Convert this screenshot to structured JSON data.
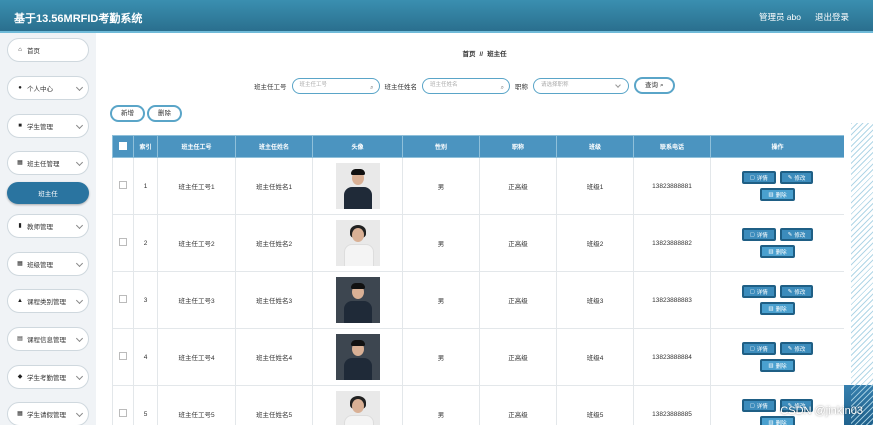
{
  "app": {
    "title": "基于13.56MRFID考勤系统"
  },
  "header": {
    "user": "管理员 abo",
    "logout": "退出登录"
  },
  "sidebar": {
    "items": [
      {
        "label": "首页",
        "icon": "home-icon"
      },
      {
        "label": "个人中心",
        "icon": "user-icon"
      },
      {
        "label": "学生管理",
        "icon": "briefcase-icon"
      },
      {
        "label": "班主任管理",
        "icon": "grid-icon"
      },
      {
        "label": "教师管理",
        "icon": "clipboard-icon"
      },
      {
        "label": "班级管理",
        "icon": "grid-icon"
      },
      {
        "label": "课程类别管理",
        "icon": "person-icon"
      },
      {
        "label": "课程信息管理",
        "icon": "table-icon"
      },
      {
        "label": "学生考勤管理",
        "icon": "pin-icon"
      },
      {
        "label": "学生请假管理",
        "icon": "grid-icon"
      }
    ],
    "submenu": {
      "label": "班主任"
    }
  },
  "breadcrumb": {
    "home": "首页",
    "separator": "//",
    "current": "班主任"
  },
  "search": {
    "field1_label": "班主任工号",
    "field1_placeholder": "班主任工号",
    "field2_label": "班主任姓名",
    "field2_placeholder": "班主任姓名",
    "field3_label": "职称",
    "field3_placeholder": "请选择职称",
    "button": "查询"
  },
  "actions": {
    "add": "新增",
    "delete": "删除"
  },
  "table": {
    "headers": [
      "索引",
      "班主任工号",
      "班主任姓名",
      "头像",
      "性别",
      "职称",
      "班级",
      "联系电话",
      "操作"
    ],
    "ops": {
      "detail": "详情",
      "edit": "修改",
      "delete": "删除"
    },
    "rows": [
      {
        "index": "1",
        "no": "班主任工号1",
        "name": "班主任姓名1",
        "gender": "男",
        "title": "正高级",
        "class": "班级1",
        "phone": "13823888881"
      },
      {
        "index": "2",
        "no": "班主任工号2",
        "name": "班主任姓名2",
        "gender": "男",
        "title": "正高级",
        "class": "班级2",
        "phone": "13823888882"
      },
      {
        "index": "3",
        "no": "班主任工号3",
        "name": "班主任姓名3",
        "gender": "男",
        "title": "正高级",
        "class": "班级3",
        "phone": "13823888883"
      },
      {
        "index": "4",
        "no": "班主任工号4",
        "name": "班主任姓名4",
        "gender": "男",
        "title": "正高级",
        "class": "班级4",
        "phone": "13823888884"
      },
      {
        "index": "5",
        "no": "班主任工号5",
        "name": "班主任姓名5",
        "gender": "男",
        "title": "正高级",
        "class": "班级5",
        "phone": "13823888885"
      }
    ]
  },
  "watermark": "CSDN @jinkin03"
}
